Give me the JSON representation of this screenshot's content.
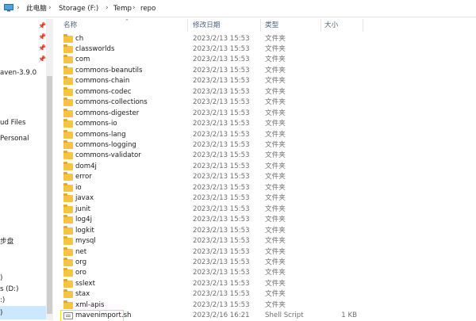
{
  "breadcrumb": {
    "items": [
      "此电脑",
      "Storage (F:)",
      "Temp",
      "repo"
    ],
    "separator": "›"
  },
  "nav": {
    "items": [
      {
        "label": "aven-3.9.0"
      },
      {
        "label": "ud Files"
      },
      {
        "label": "Personal"
      },
      {
        "label": "步盘"
      },
      {
        "label": ")"
      },
      {
        "label": "s (D:)"
      },
      {
        "label": ":)"
      },
      {
        "label": ")"
      }
    ]
  },
  "columns": {
    "name": "名称",
    "date": "修改日期",
    "type": "类型",
    "size": "大小"
  },
  "files": [
    {
      "name": "ch",
      "date": "2023/2/13 15:53",
      "type": "文件夹",
      "size": "",
      "icon": "folder-icon"
    },
    {
      "name": "classworlds",
      "date": "2023/2/13 15:53",
      "type": "文件夹",
      "size": "",
      "icon": "folder-icon"
    },
    {
      "name": "com",
      "date": "2023/2/13 15:53",
      "type": "文件夹",
      "size": "",
      "icon": "folder-icon"
    },
    {
      "name": "commons-beanutils",
      "date": "2023/2/13 15:53",
      "type": "文件夹",
      "size": "",
      "icon": "folder-icon"
    },
    {
      "name": "commons-chain",
      "date": "2023/2/13 15:53",
      "type": "文件夹",
      "size": "",
      "icon": "folder-icon"
    },
    {
      "name": "commons-codec",
      "date": "2023/2/13 15:53",
      "type": "文件夹",
      "size": "",
      "icon": "folder-icon"
    },
    {
      "name": "commons-collections",
      "date": "2023/2/13 15:53",
      "type": "文件夹",
      "size": "",
      "icon": "folder-icon"
    },
    {
      "name": "commons-digester",
      "date": "2023/2/13 15:53",
      "type": "文件夹",
      "size": "",
      "icon": "folder-icon"
    },
    {
      "name": "commons-io",
      "date": "2023/2/13 15:53",
      "type": "文件夹",
      "size": "",
      "icon": "folder-icon"
    },
    {
      "name": "commons-lang",
      "date": "2023/2/13 15:53",
      "type": "文件夹",
      "size": "",
      "icon": "folder-icon"
    },
    {
      "name": "commons-logging",
      "date": "2023/2/13 15:53",
      "type": "文件夹",
      "size": "",
      "icon": "folder-icon"
    },
    {
      "name": "commons-validator",
      "date": "2023/2/13 15:53",
      "type": "文件夹",
      "size": "",
      "icon": "folder-icon"
    },
    {
      "name": "dom4j",
      "date": "2023/2/13 15:53",
      "type": "文件夹",
      "size": "",
      "icon": "folder-icon"
    },
    {
      "name": "error",
      "date": "2023/2/13 15:53",
      "type": "文件夹",
      "size": "",
      "icon": "folder-icon"
    },
    {
      "name": "io",
      "date": "2023/2/13 15:53",
      "type": "文件夹",
      "size": "",
      "icon": "folder-icon"
    },
    {
      "name": "javax",
      "date": "2023/2/13 15:53",
      "type": "文件夹",
      "size": "",
      "icon": "folder-icon"
    },
    {
      "name": "junit",
      "date": "2023/2/13 15:53",
      "type": "文件夹",
      "size": "",
      "icon": "folder-icon"
    },
    {
      "name": "log4j",
      "date": "2023/2/13 15:53",
      "type": "文件夹",
      "size": "",
      "icon": "folder-icon"
    },
    {
      "name": "logkit",
      "date": "2023/2/13 15:53",
      "type": "文件夹",
      "size": "",
      "icon": "folder-icon"
    },
    {
      "name": "mysql",
      "date": "2023/2/13 15:53",
      "type": "文件夹",
      "size": "",
      "icon": "folder-icon"
    },
    {
      "name": "net",
      "date": "2023/2/13 15:53",
      "type": "文件夹",
      "size": "",
      "icon": "folder-icon"
    },
    {
      "name": "org",
      "date": "2023/2/13 15:53",
      "type": "文件夹",
      "size": "",
      "icon": "folder-icon"
    },
    {
      "name": "oro",
      "date": "2023/2/13 15:53",
      "type": "文件夹",
      "size": "",
      "icon": "folder-icon"
    },
    {
      "name": "sslext",
      "date": "2023/2/13 15:53",
      "type": "文件夹",
      "size": "",
      "icon": "folder-icon"
    },
    {
      "name": "stax",
      "date": "2023/2/13 15:53",
      "type": "文件夹",
      "size": "",
      "icon": "folder-icon"
    },
    {
      "name": "xml-apis",
      "date": "2023/2/13 15:53",
      "type": "文件夹",
      "size": "",
      "icon": "folder-icon"
    },
    {
      "name": "mavenimport.sh",
      "date": "2023/2/16 16:21",
      "type": "Shell Script",
      "size": "1 KB",
      "icon": "script-file-icon",
      "highlighted": true
    }
  ],
  "colors": {
    "folder": "#f5c542",
    "highlight_border": "#f2e020",
    "header_text": "#4c607a",
    "selected_nav": "#cce8ff"
  }
}
